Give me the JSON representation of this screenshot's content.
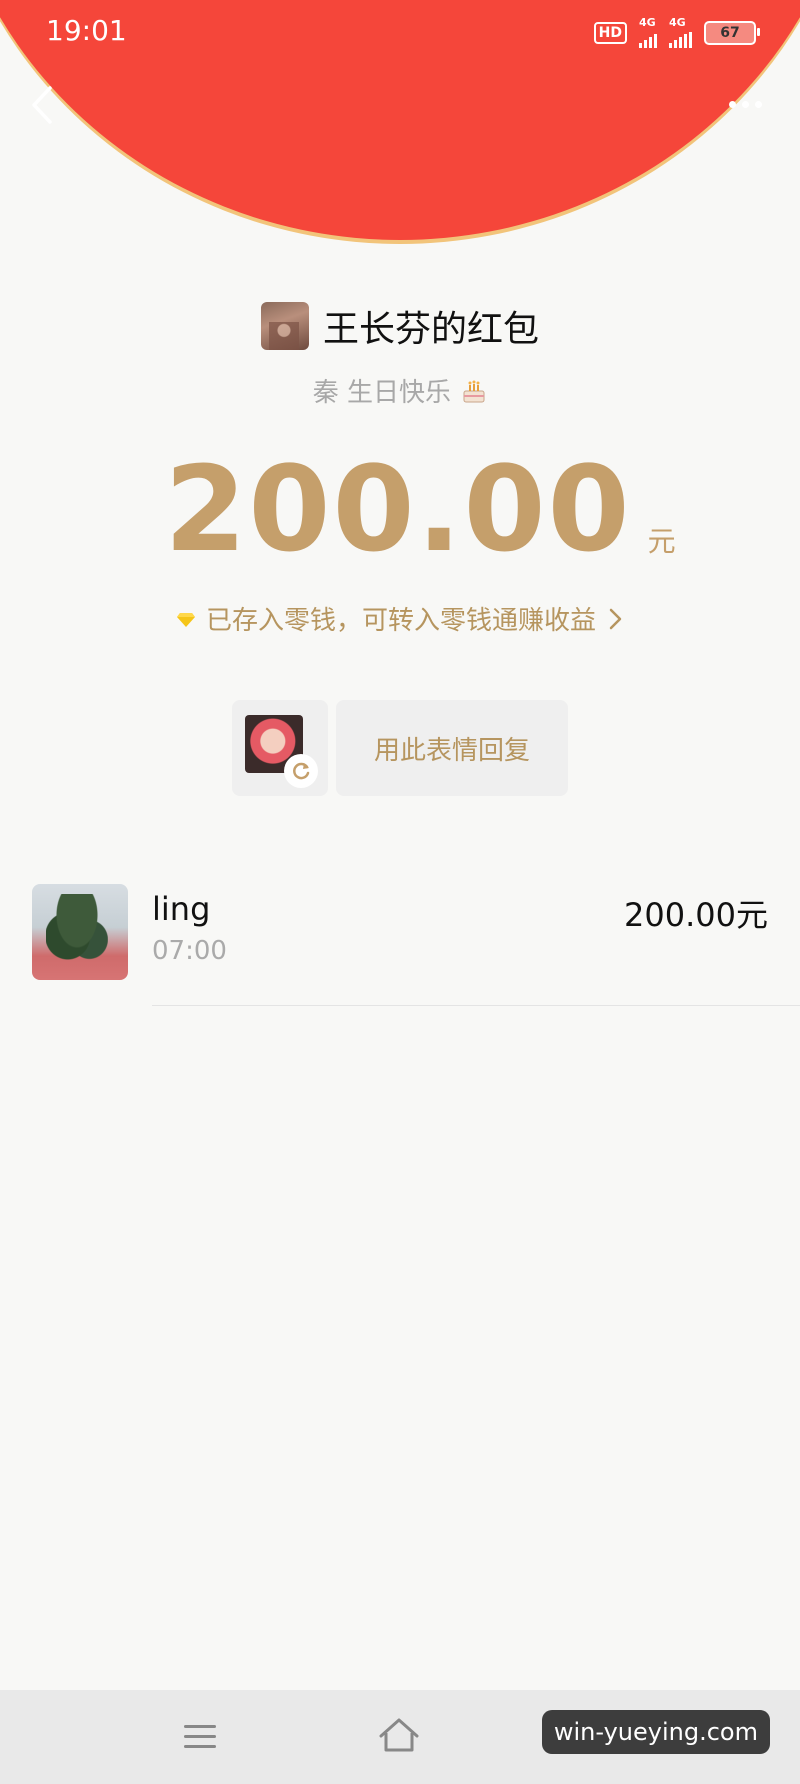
{
  "status_bar": {
    "time": "19:01",
    "hd": "HD",
    "network_1": "4G",
    "network_2": "4G",
    "battery": "67"
  },
  "header": {
    "back_icon": "chevron-left-icon",
    "more_icon": "more-dots-icon",
    "color": "#f5463a"
  },
  "packet": {
    "title": "王长芬的红包",
    "blessing": "秦 生日快乐",
    "amount": "200.00",
    "unit": "元",
    "notice": "已存入零钱，可转入零钱通赚收益",
    "reply_button": "用此表情回复",
    "accent_color": "#c59f6b"
  },
  "receivers": [
    {
      "name": "ling",
      "time": "07:00",
      "amount": "200.00元"
    }
  ],
  "nav": {
    "menu_icon": "menu-icon",
    "home_icon": "home-icon"
  },
  "watermark": "win-yueying.com"
}
